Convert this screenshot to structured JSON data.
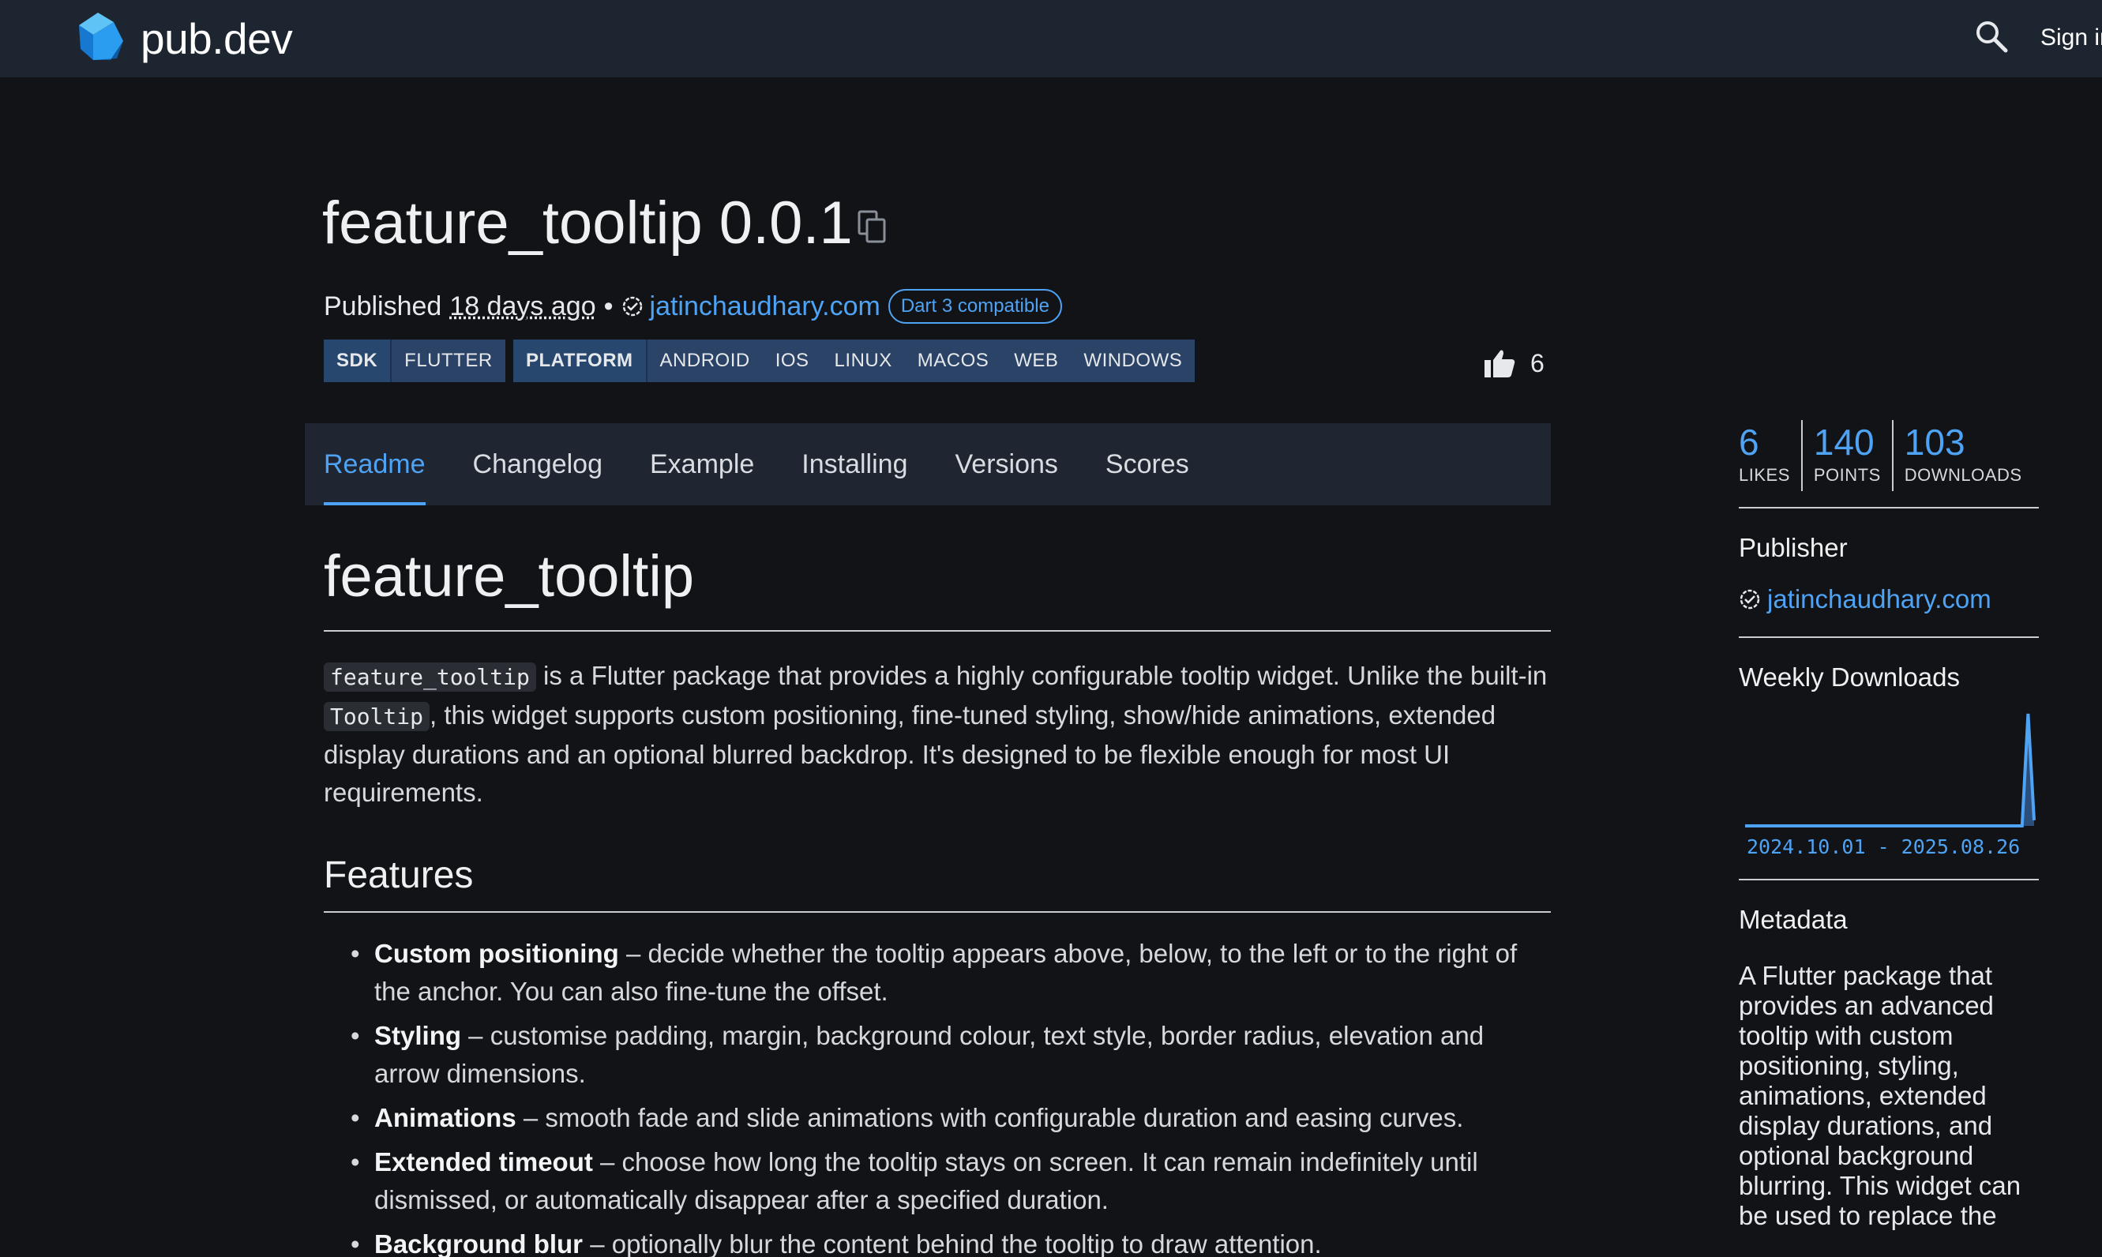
{
  "topbar": {
    "brand": "pub.dev",
    "signin_label": "Sign in"
  },
  "package": {
    "title": "feature_tooltip 0.0.1",
    "published_prefix": "Published",
    "published_ago": "18 days ago",
    "separator": "•",
    "publisher": "jatinchaudhary.com",
    "dart3_badge": "Dart 3 compatible",
    "sdk": {
      "head": "SDK",
      "values": [
        "FLUTTER"
      ]
    },
    "platform": {
      "head": "PLATFORM",
      "values": [
        "ANDROID",
        "IOS",
        "LINUX",
        "MACOS",
        "WEB",
        "WINDOWS"
      ]
    },
    "likes_count": "6"
  },
  "tabs": [
    "Readme",
    "Changelog",
    "Example",
    "Installing",
    "Versions",
    "Scores"
  ],
  "active_tab": "Readme",
  "readme": {
    "h1": "feature_tooltip",
    "intro": {
      "code1": "feature_tooltip",
      "text1": " is a Flutter package that provides a highly configurable tooltip widget. Unlike the built-in ",
      "code2": "Tooltip",
      "text2": ", this widget supports custom positioning, fine-tuned styling, show/hide animations, extended display durations and an optional blurred backdrop. It's designed to be flexible enough for most UI requirements."
    },
    "features_heading": "Features",
    "features": [
      {
        "title": "Custom positioning",
        "desc": " – decide whether the tooltip appears above, below, to the left or to the right of the anchor. You can also fine-tune the offset."
      },
      {
        "title": "Styling",
        "desc": " – customise padding, margin, background colour, text style, border radius, elevation and arrow dimensions."
      },
      {
        "title": "Animations",
        "desc": " – smooth fade and slide animations with configurable duration and easing curves."
      },
      {
        "title": "Extended timeout",
        "desc": " – choose how long the tooltip stays on screen. It can remain indefinitely until dismissed, or automatically disappear after a specified duration."
      },
      {
        "title": "Background blur",
        "desc": " – optionally blur the content behind the tooltip to draw attention."
      }
    ]
  },
  "sidebar": {
    "stats": [
      {
        "value": "6",
        "label": "LIKES"
      },
      {
        "value": "140",
        "label": "POINTS"
      },
      {
        "value": "103",
        "label": "DOWNLOADS"
      }
    ],
    "publisher_heading": "Publisher",
    "publisher": "jatinchaudhary.com",
    "weekly_heading": "Weekly Downloads",
    "date_range": "2024.10.01 - 2025.08.26",
    "metadata_heading": "Metadata",
    "metadata_desc": "A Flutter package that provides an advanced tooltip with custom positioning, styling, animations, extended display durations, and optional background blurring. This widget can be used to replace the"
  },
  "chart_data": {
    "type": "area",
    "title": "Weekly Downloads",
    "xlabel": "",
    "ylabel": "",
    "x_range": [
      "2024.10.01",
      "2025.08.26"
    ],
    "series": [
      {
        "values": [
          0,
          0,
          0,
          0,
          0,
          0,
          0,
          0,
          0,
          0,
          0,
          0,
          0,
          0,
          0,
          0,
          0,
          0,
          0,
          0,
          0,
          0,
          0,
          0,
          0,
          0,
          0,
          0,
          0,
          0,
          0,
          0,
          0,
          0,
          0,
          0,
          0,
          0,
          0,
          0,
          0,
          0,
          0,
          0,
          0,
          0,
          0,
          1,
          0.05
        ]
      }
    ],
    "grid": false,
    "legend": "none",
    "colors": {
      "line": "#4fa3f5",
      "fill": "#2b4f7a"
    }
  },
  "colors": {
    "accent": "#4fa3f5",
    "background": "#121316",
    "topbar": "#1d2530",
    "tag_bg": "#2a4366"
  },
  "icons": [
    "dart-logo-icon",
    "search-icon",
    "copy-icon",
    "verified-publisher-icon",
    "thumb-up-icon"
  ]
}
